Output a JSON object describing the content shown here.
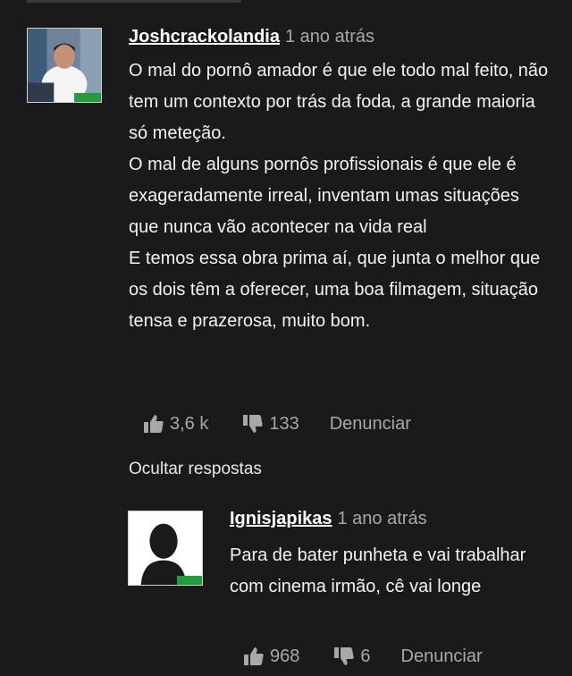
{
  "comment": {
    "username": "Joshcrackolandia",
    "timestamp": "1 ano atrás",
    "paragraphs": [
      "O mal do pornô amador é que ele todo mal feito, não tem um contexto por trás da foda, a grande maioria só meteção.",
      "O mal de alguns pornôs profissionais é que ele é exageradamente irreal, inventam umas situações que nunca vão acontecer na vida real",
      "E temos essa obra prima aí, que junta o melhor que os dois têm a oferecer, uma boa filmagem, situação tensa e prazerosa, muito bom."
    ],
    "likes": "3,6 k",
    "dislikes": "133",
    "report_label": "Denunciar"
  },
  "hide_replies_label": "Ocultar respostas",
  "reply": {
    "username": "Ignisjapikas",
    "timestamp": "1 ano atrás",
    "text": "Para de bater punheta e vai trabalhar com cinema irmão, cê vai longe",
    "likes": "968",
    "dislikes": "6",
    "report_label": "Denunciar"
  },
  "colors": {
    "background": "#1a1a1a",
    "text": "#f2f2f2",
    "muted": "#a8a8a8"
  }
}
